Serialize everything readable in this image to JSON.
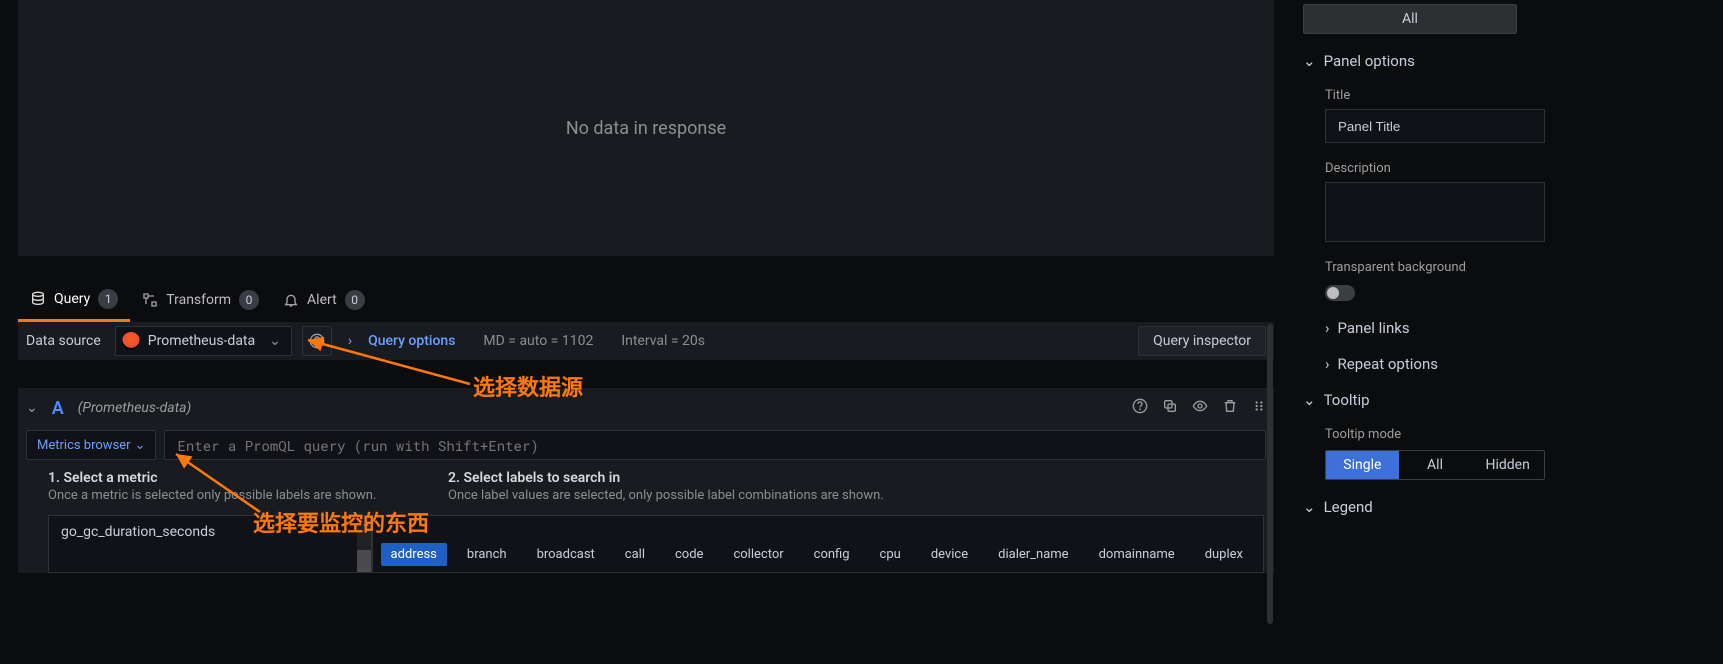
{
  "viz": {
    "empty_text": "No data in response"
  },
  "tabs": {
    "query": {
      "label": "Query",
      "count": "1"
    },
    "transform": {
      "label": "Transform",
      "count": "0"
    },
    "alert": {
      "label": "Alert",
      "count": "0"
    }
  },
  "datasource": {
    "label": "Data source",
    "selected": "Prometheus-data",
    "query_options_label": "Query options",
    "meta_md": "MD = auto = 1102",
    "meta_interval": "Interval = 20s",
    "inspector_label": "Query inspector"
  },
  "query": {
    "letter": "A",
    "ds_display": "(Prometheus-data)",
    "metrics_browser_label": "Metrics browser",
    "promql_placeholder": "Enter a PromQL query (run with Shift+Enter)",
    "helper1_title": "1. Select a metric",
    "helper1_text": "Once a metric is selected only possible labels are shown.",
    "helper2_title": "2. Select labels to search in",
    "helper2_text": "Once label values are selected, only possible label combinations are shown.",
    "metric_item": "go_gc_duration_seconds",
    "labels": [
      "address",
      "branch",
      "broadcast",
      "call",
      "code",
      "collector",
      "config",
      "cpu",
      "device",
      "dialer_name",
      "domainname",
      "duplex"
    ]
  },
  "annotations": {
    "ds": "选择数据源",
    "mb": "选择要监控的东西"
  },
  "sidebar": {
    "all_btn": "All",
    "panel_options_title": "Panel options",
    "title_label": "Title",
    "title_value": "Panel Title",
    "description_label": "Description",
    "transparent_label": "Transparent background",
    "panel_links_title": "Panel links",
    "repeat_title": "Repeat options",
    "tooltip_title": "Tooltip",
    "tooltip_mode_label": "Tooltip mode",
    "tooltip_modes": [
      "Single",
      "All",
      "Hidden"
    ],
    "legend_title": "Legend"
  }
}
